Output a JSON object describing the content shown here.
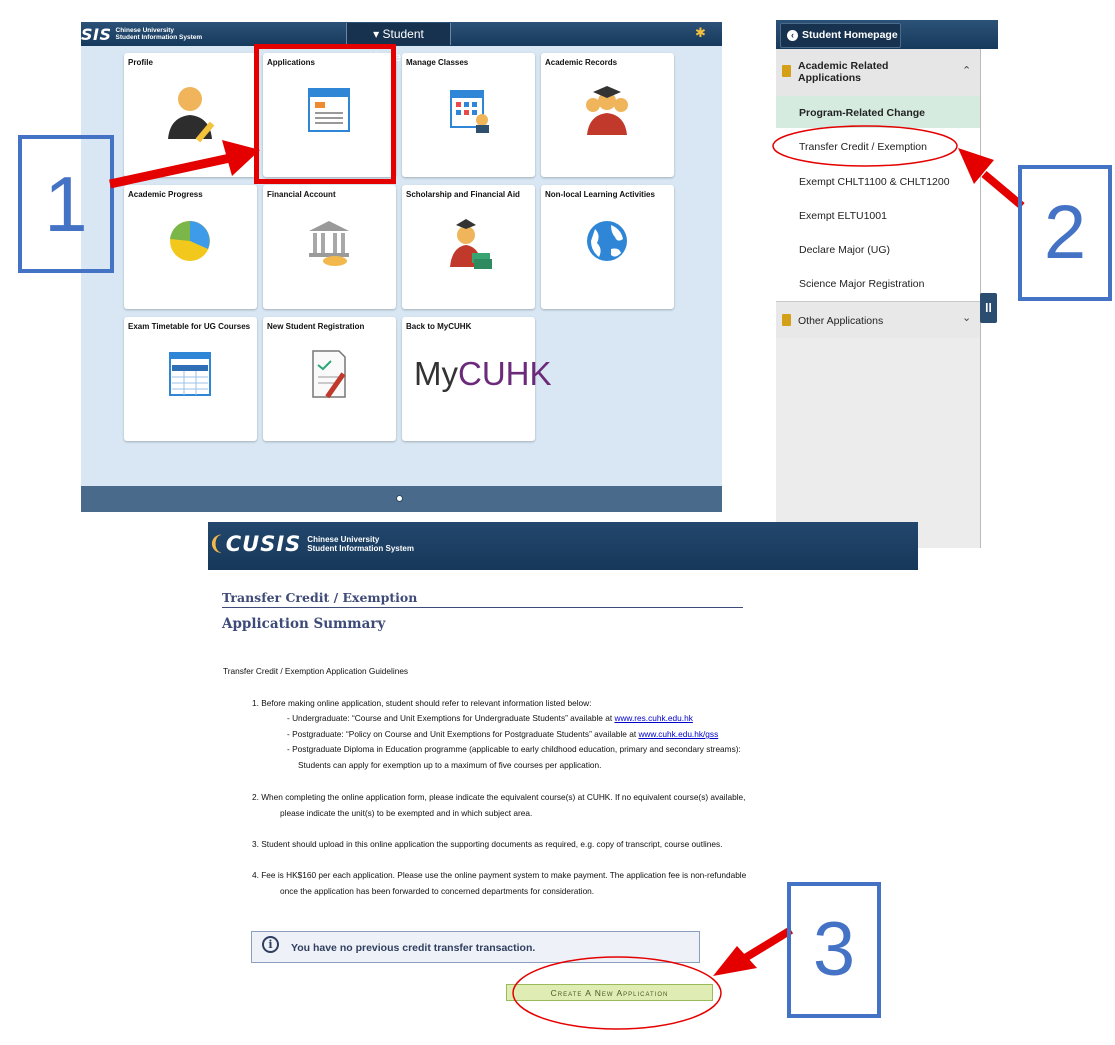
{
  "homepage": {
    "logo_big": "SIS",
    "logo_line1": "Chinese University",
    "logo_line2": "Student Information System",
    "nav_title": "▾ Student Homepage",
    "tiles": [
      {
        "label": "Profile"
      },
      {
        "label": "Applications"
      },
      {
        "label": "Manage Classes"
      },
      {
        "label": "Academic Records"
      },
      {
        "label": "Academic Progress"
      },
      {
        "label": "Financial Account"
      },
      {
        "label": "Scholarship and Financial Aid"
      },
      {
        "label": "Non-local Learning Activities"
      },
      {
        "label": "Exam Timetable for UG Courses"
      },
      {
        "label": "New Student Registration"
      },
      {
        "label": "Back to MyCUHK"
      }
    ],
    "mycuhk_my": "My",
    "mycuhk_cuhk": "CUHK"
  },
  "steps": [
    "1",
    "2",
    "3"
  ],
  "sidebar": {
    "back_label": "Student Homepage",
    "group1": "Academic Related Applications",
    "items": [
      "Program-Related Change",
      "Transfer Credit / Exemption",
      "Exempt CHLT1100 & CHLT1200",
      "Exempt ELTU1001",
      "Declare Major (UG)",
      "Science Major Registration"
    ],
    "group2": "Other Applications",
    "pause_icon": "ll"
  },
  "summary": {
    "logo_big": "CUSIS",
    "logo_line1": "Chinese University",
    "logo_line2": "Student Information System",
    "title": "Transfer Credit / Exemption",
    "subtitle": "Application Summary",
    "guidelines_title": "Transfer Credit / Exemption Application Guidelines",
    "g1": "1. Before making online application, student should refer to relevant information listed below:",
    "g1a_pre": "- Undergraduate: “Course and Unit Exemptions for Undergraduate Students” available at ",
    "g1a_link": "www.res.cuhk.edu.hk",
    "g1b_pre": "- Postgraduate: “Policy on Course and Unit Exemptions for Postgraduate Students” available at ",
    "g1b_link": "www.cuhk.edu.hk/gss",
    "g1c_l1": "- Postgraduate Diploma in Education programme (applicable to early childhood education, primary and secondary streams):",
    "g1c_l2": "Students can apply for exemption up to a maximum of five courses per application.",
    "g2_l1": "2. When completing the online application form, please indicate the equivalent course(s) at CUHK. If no equivalent course(s) available,",
    "g2_l2": "please indicate the unit(s) to be exempted and in which subject area.",
    "g3": "3. Student should upload in this online application the supporting documents as required, e.g. copy of transcript, course outlines.",
    "g4_l1": "4. Fee is HK$160 per each application. Please use the online payment system to make payment. The application fee is non-refundable",
    "g4_l2": "once the application has been forwarded to concerned departments for consideration.",
    "notice": "You have no previous credit transfer transaction.",
    "create_button": "Create A New Application",
    "info_icon": "i"
  }
}
